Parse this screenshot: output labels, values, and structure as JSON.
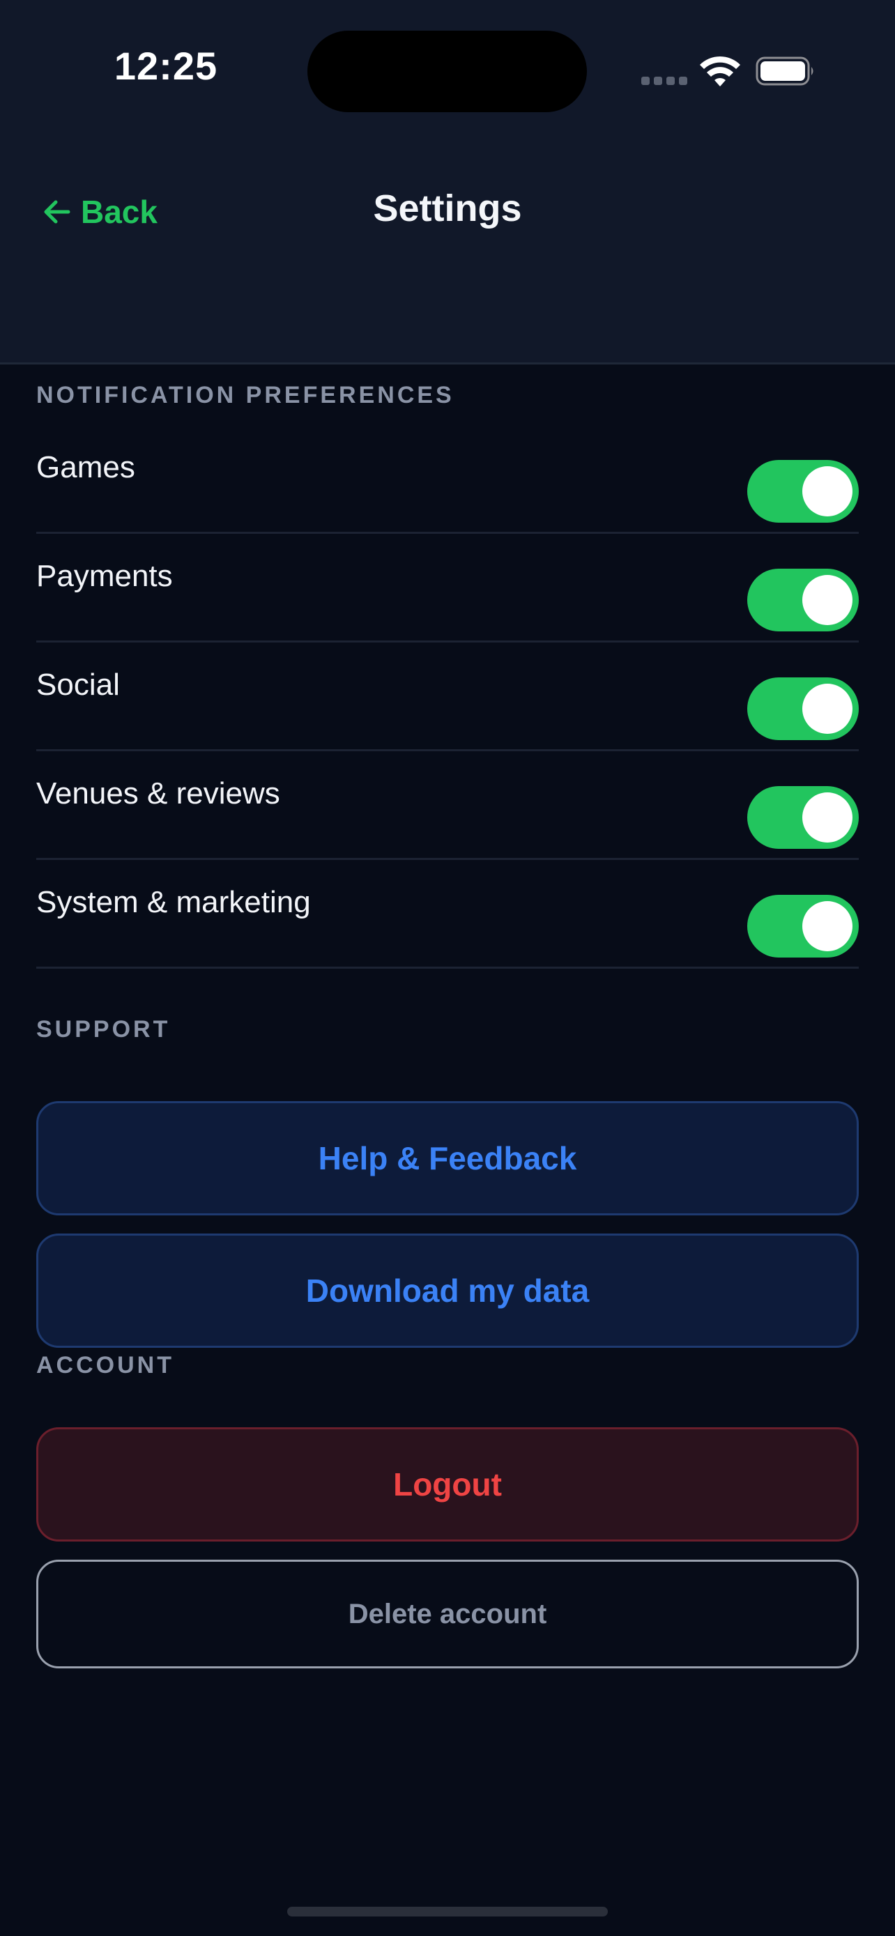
{
  "status_bar": {
    "time": "12:25",
    "icons": [
      "signal-dots-icon",
      "wifi-icon",
      "battery-icon"
    ]
  },
  "nav": {
    "back_label": "Back",
    "back_icon": "arrow-left-icon",
    "title": "Settings"
  },
  "sections": {
    "notifications": {
      "header": "NOTIFICATION PREFERENCES",
      "items": [
        {
          "label": "Games",
          "enabled": true
        },
        {
          "label": "Payments",
          "enabled": true
        },
        {
          "label": "Social",
          "enabled": true
        },
        {
          "label": "Venues & reviews",
          "enabled": true
        },
        {
          "label": "System & marketing",
          "enabled": true
        }
      ]
    },
    "support": {
      "header": "SUPPORT",
      "help_label": "Help & Feedback",
      "download_label": "Download my data"
    },
    "account": {
      "header": "ACCOUNT",
      "logout_label": "Logout",
      "delete_label": "Delete account"
    }
  },
  "colors": {
    "accent_green": "#22c55e",
    "link_blue": "#3b82f6",
    "danger_red": "#ef4444",
    "background": "#070c18",
    "header_bg": "#111829"
  }
}
